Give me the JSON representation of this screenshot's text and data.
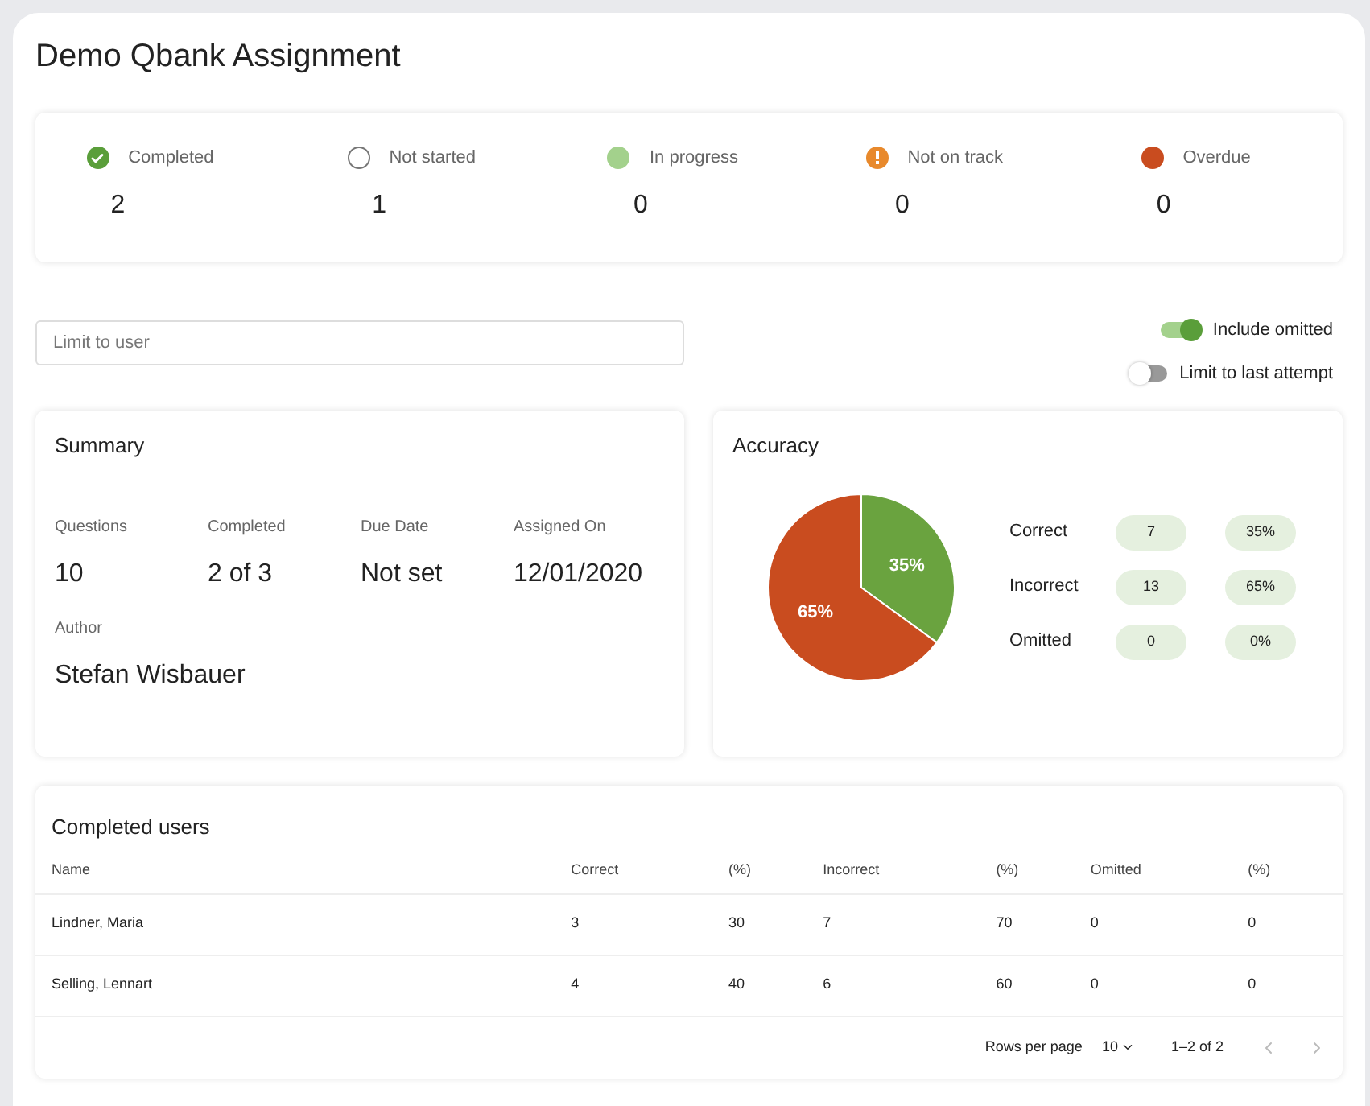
{
  "title": "Demo Qbank Assignment",
  "statuses": [
    {
      "kind": "check",
      "label": "Completed",
      "count": "2",
      "color": "#5a9e3a"
    },
    {
      "kind": "ring",
      "label": "Not started",
      "count": "1",
      "color": "#777777"
    },
    {
      "kind": "dot",
      "label": "In progress",
      "count": "0",
      "color": "#a3d18c"
    },
    {
      "kind": "alert",
      "label": "Not on track",
      "count": "0",
      "color": "#e8892c"
    },
    {
      "kind": "dot",
      "label": "Overdue",
      "count": "0",
      "color": "#c94c1f"
    }
  ],
  "user_filter": {
    "placeholder": "Limit to user"
  },
  "toggles": [
    {
      "label": "Include omitted",
      "on": true
    },
    {
      "label": "Limit to last attempt",
      "on": false
    }
  ],
  "summary": {
    "title": "Summary",
    "fields": [
      {
        "label": "Questions",
        "value": "10"
      },
      {
        "label": "Completed",
        "value": "2 of 3"
      },
      {
        "label": "Due Date",
        "value": "Not set"
      },
      {
        "label": "Assigned On",
        "value": "12/01/2020"
      }
    ],
    "author": {
      "label": "Author",
      "value": "Stefan Wisbauer"
    }
  },
  "accuracy": {
    "title": "Accuracy",
    "chart_data": {
      "type": "pie",
      "categories": [
        "Correct",
        "Incorrect"
      ],
      "values": [
        35,
        65
      ],
      "colors": [
        "#6aa33f",
        "#c94c1f"
      ],
      "value_labels": [
        "35%",
        "65%"
      ]
    },
    "legend": [
      {
        "count": "7",
        "percent": "35%"
      },
      {
        "count": "13",
        "percent": "65%"
      },
      {
        "label": "Omitted",
        "count": "0",
        "percent": "0%"
      }
    ]
  },
  "completed_users": {
    "title": "Completed users",
    "columns": [
      "Name",
      "Correct",
      "(%)",
      "Incorrect",
      "(%)",
      "Omitted",
      "(%)"
    ],
    "rows": [
      [
        "Lindner, Maria",
        "3",
        "30",
        "7",
        "70",
        "0",
        "0"
      ],
      [
        "Selling, Lennart",
        "4",
        "40",
        "6",
        "60",
        "0",
        "0"
      ]
    ],
    "pagination": {
      "rows_per_page_label": "Rows per page",
      "rows_per_page": "10",
      "range": "1–2 of 2",
      "prev_disabled": true,
      "next_disabled": true
    }
  }
}
